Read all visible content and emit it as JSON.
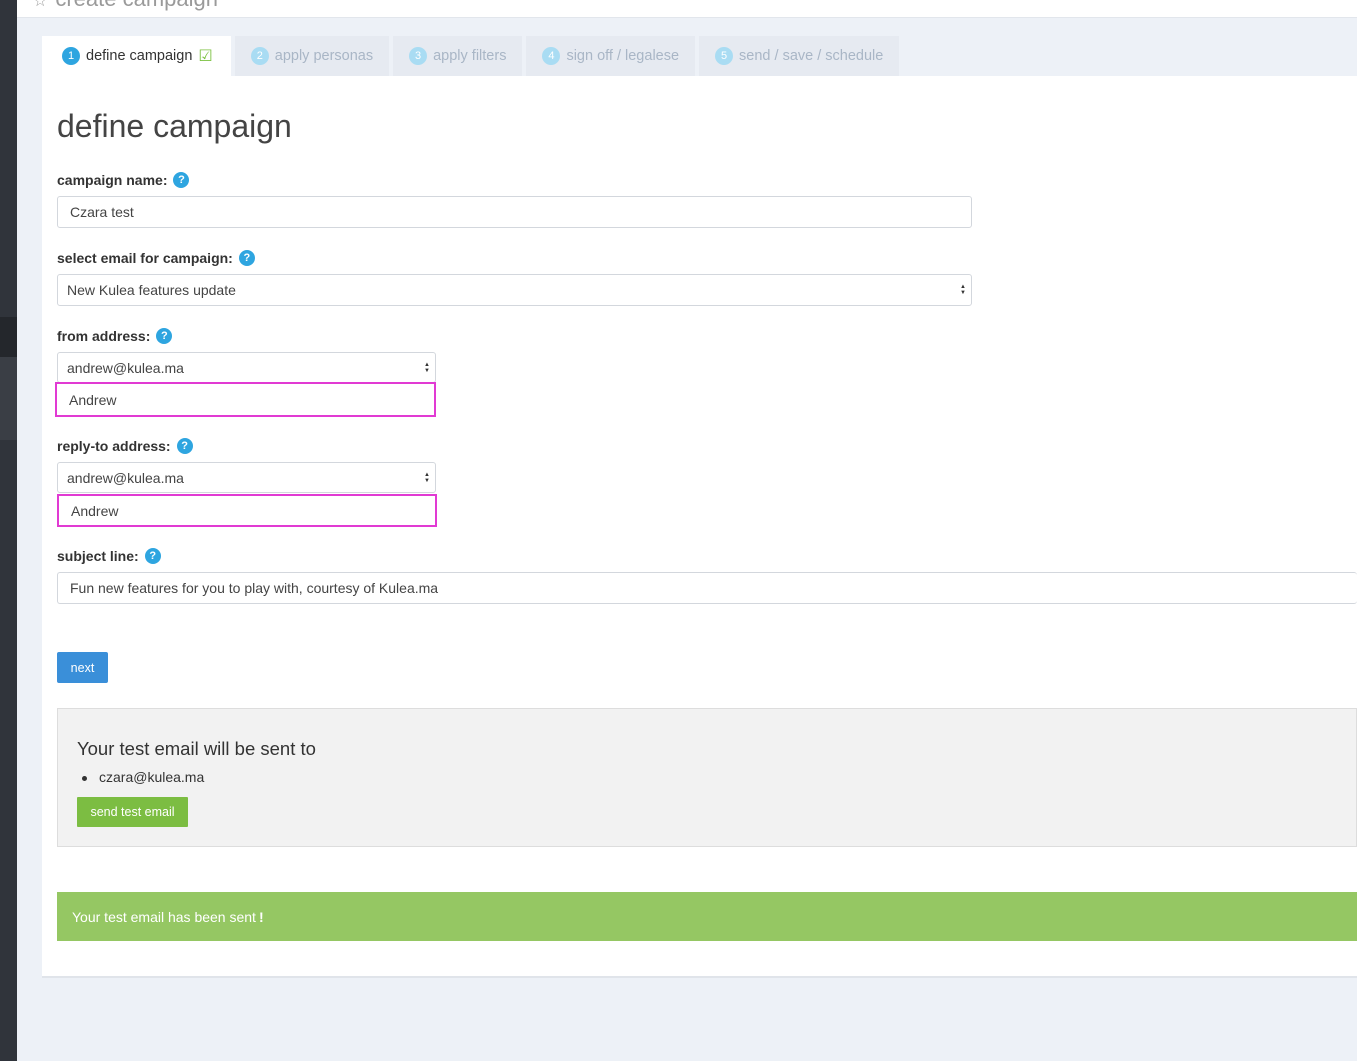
{
  "app": {
    "title": "create campaign"
  },
  "tabs": [
    {
      "num": "1",
      "label": "define campaign",
      "active": true
    },
    {
      "num": "2",
      "label": "apply personas",
      "active": false
    },
    {
      "num": "3",
      "label": "apply filters",
      "active": false
    },
    {
      "num": "4",
      "label": "sign off / legalese",
      "active": false
    },
    {
      "num": "5",
      "label": "send / save / schedule",
      "active": false
    }
  ],
  "page": {
    "title": "define campaign"
  },
  "form": {
    "campaign_name": {
      "label": "campaign name:",
      "value": "Czara test"
    },
    "select_email": {
      "label": "select email for campaign:",
      "value": "New Kulea features update"
    },
    "from_address": {
      "label": "from address:",
      "value": "andrew@kulea.ma",
      "name_value": "Andrew"
    },
    "reply_to_address": {
      "label": "reply-to address:",
      "value": "andrew@kulea.ma",
      "name_value": "Andrew"
    },
    "subject_line": {
      "label": "subject line:",
      "value": "Fun new features for you to play with, courtesy of Kulea.ma"
    },
    "next_label": "next"
  },
  "test_email": {
    "title": "Your test email will be sent to",
    "recipients": [
      "czara@kulea.ma"
    ],
    "send_label": "send test email"
  },
  "alert": {
    "message": "Your test email has been sent",
    "emphasis": "!"
  },
  "colors": {
    "accent": "#2ea5e0",
    "primary_button": "#3a8fd9",
    "success_button": "#7cbd42",
    "alert_bg": "#95c763",
    "highlight_border": "#e13ad3",
    "sidebar": "#30343b"
  },
  "icons": {
    "star": "star-icon",
    "check": "check-icon",
    "help": "help-icon",
    "select_arrows": "select-arrows-icon"
  }
}
